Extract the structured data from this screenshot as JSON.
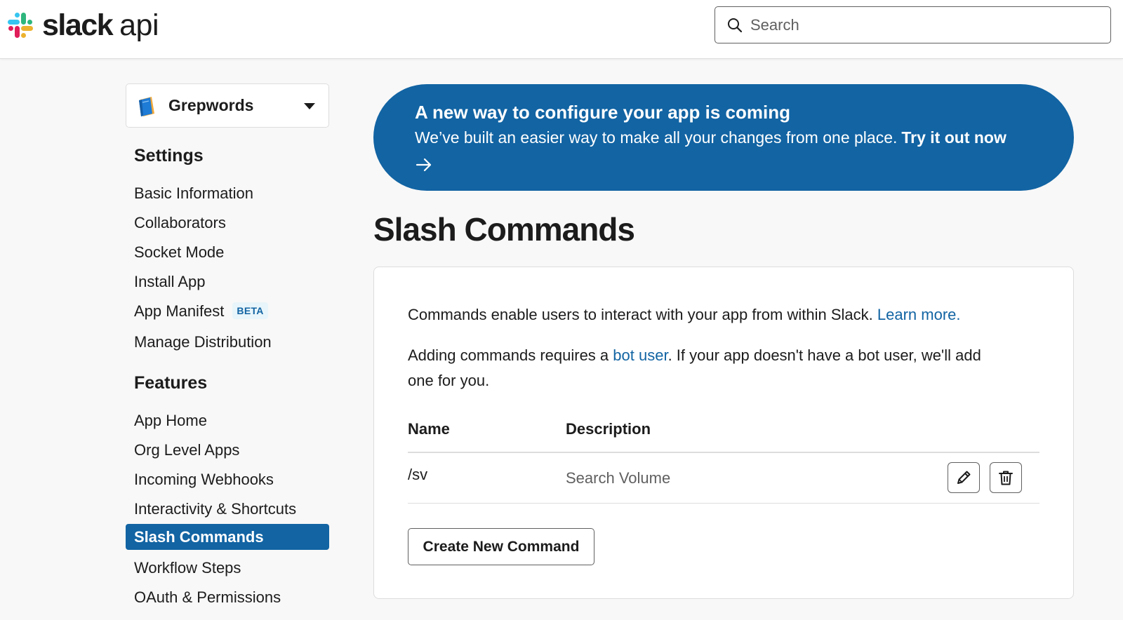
{
  "header": {
    "logo_word": "slack",
    "logo_suffix": "api",
    "search_placeholder": "Search"
  },
  "sidebar": {
    "app_name": "Grepwords",
    "settings_heading": "Settings",
    "settings_items": [
      {
        "label": "Basic Information"
      },
      {
        "label": "Collaborators"
      },
      {
        "label": "Socket Mode"
      },
      {
        "label": "Install App"
      },
      {
        "label": "App Manifest",
        "badge": "BETA"
      },
      {
        "label": "Manage Distribution"
      }
    ],
    "features_heading": "Features",
    "features_items": [
      {
        "label": "App Home"
      },
      {
        "label": "Org Level Apps"
      },
      {
        "label": "Incoming Webhooks"
      },
      {
        "label": "Interactivity & Shortcuts"
      },
      {
        "label": "Slash Commands",
        "active": true
      },
      {
        "label": "Workflow Steps"
      },
      {
        "label": "OAuth & Permissions"
      }
    ]
  },
  "banner": {
    "title": "A new way to configure your app is coming",
    "body": "We’ve built an easier way to make all your changes from one place.",
    "cta": "Try it out now"
  },
  "main": {
    "title": "Slash Commands",
    "intro_text": "Commands enable users to interact with your app from within Slack.",
    "intro_link": "Learn more.",
    "bot_text_before": "Adding commands requires a",
    "bot_link": "bot user",
    "bot_text_after": ". If your app doesn't have a bot user, we'll add",
    "bot_text_line2": "one for you.",
    "table": {
      "columns": [
        "Name",
        "Description"
      ],
      "rows": [
        {
          "name": "/sv",
          "description": "Search Volume"
        }
      ]
    },
    "create_button": "Create New Command"
  },
  "colors": {
    "brand_blue": "#1264a3",
    "text": "#1d1c1d",
    "muted": "#616061",
    "border": "#dddddd"
  },
  "icons": {
    "logo": "slack-hash-icon",
    "search": "search-icon",
    "app": "book-icon",
    "dropdown": "caret-down-icon",
    "banner_arrow": "arrow-right-icon",
    "edit": "pencil-icon",
    "delete": "trash-icon"
  }
}
